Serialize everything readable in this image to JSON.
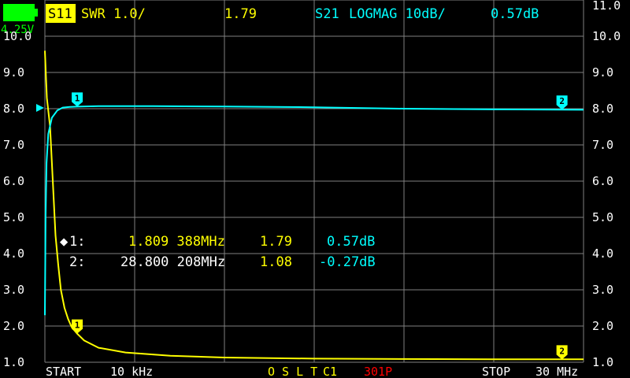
{
  "colors": {
    "s11": "#ffff00",
    "s21": "#00ffff",
    "grid": "#808080",
    "battery": "#00ff00",
    "sweep_points": "#ff0000"
  },
  "status": {
    "battery_voltage": "4.25V",
    "battery_icon": "battery-icon"
  },
  "header": {
    "trace1": {
      "channel": "S11",
      "format": "SWR 1.0/",
      "value": "1.79"
    },
    "trace2": {
      "channel": "S21",
      "format": "LOGMAG 10dB/",
      "value": "0.57dB"
    }
  },
  "axis": {
    "left_labels": [
      "10.0",
      "9.0",
      "8.0",
      "7.0",
      "6.0",
      "5.0",
      "4.0",
      "3.0",
      "2.0",
      "1.0"
    ],
    "right_labels": [
      "11.0",
      "10.0",
      "9.0",
      "8.0",
      "7.0",
      "6.0",
      "5.0",
      "4.0",
      "3.0",
      "2.0",
      "1.0"
    ]
  },
  "markers": [
    {
      "indicator": "◆",
      "label": "1:",
      "frequency": "1.809 388MHz",
      "swr": "1.79",
      "logmag": "0.57dB"
    },
    {
      "indicator": "",
      "label": "2:",
      "frequency": "28.800 208MHz",
      "swr": "1.08",
      "logmag": "-0.27dB"
    }
  ],
  "footer": {
    "start_label": "START",
    "start_value": "10 kHz",
    "cal_status": "O S L T",
    "cal_slot": "C1",
    "points": "301P",
    "stop_label": "STOP",
    "stop_value": "30 MHz"
  },
  "chart_data": {
    "type": "line",
    "x_unit": "MHz",
    "x_range": [
      0.01,
      30
    ],
    "y_range": [
      1.0,
      11.0
    ],
    "series": [
      {
        "name": "S11",
        "color": "#ffff00",
        "x": [
          0.01,
          0.12,
          0.3,
          0.4,
          0.5,
          0.6,
          0.75,
          0.9,
          1.1,
          1.3,
          1.5,
          1.809,
          2.2,
          3.0,
          4.5,
          7.0,
          10.0,
          15.0,
          20.0,
          25.0,
          28.8,
          30.0
        ],
        "values": [
          9.6,
          8.3,
          7.5,
          6.5,
          5.5,
          4.5,
          3.7,
          3.0,
          2.5,
          2.2,
          1.97,
          1.79,
          1.6,
          1.4,
          1.27,
          1.18,
          1.13,
          1.1,
          1.09,
          1.08,
          1.08,
          1.08
        ]
      },
      {
        "name": "S21",
        "color": "#00ffff",
        "x": [
          0.01,
          0.05,
          0.1,
          0.2,
          0.4,
          0.7,
          1.0,
          1.4,
          1.809,
          3.0,
          6.0,
          10.0,
          15.0,
          20.0,
          25.0,
          28.8,
          30.0
        ],
        "values": [
          2.3,
          5.0,
          6.5,
          7.3,
          7.75,
          7.95,
          8.03,
          8.05,
          8.057,
          8.07,
          8.07,
          8.06,
          8.04,
          8.0,
          7.98,
          7.973,
          7.97
        ]
      }
    ],
    "markers": [
      {
        "id": "1",
        "x": 1.809,
        "s11": 1.79,
        "s21_plot": 8.057
      },
      {
        "id": "2",
        "x": 28.8,
        "s11": 1.08,
        "s21_plot": 7.973
      }
    ],
    "reference_marker_y": 8.0
  }
}
